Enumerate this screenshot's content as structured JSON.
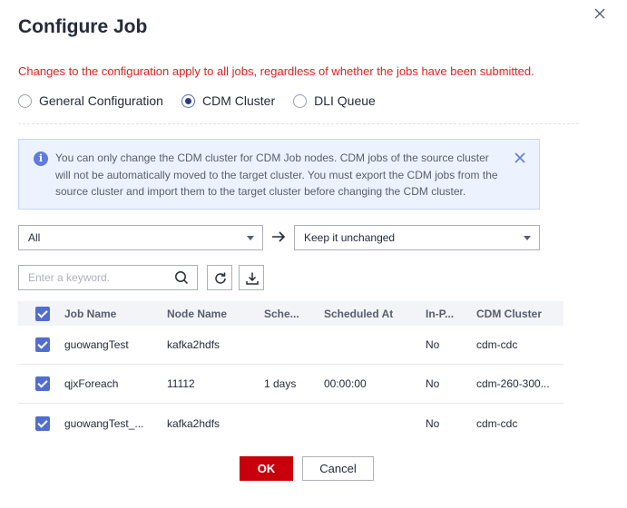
{
  "dialog": {
    "title": "Configure Job",
    "warning": "Changes to the configuration apply to all jobs, regardless of whether the jobs have been submitted."
  },
  "tabs": [
    {
      "label": "General Configuration",
      "selected": false
    },
    {
      "label": "CDM Cluster",
      "selected": true
    },
    {
      "label": "DLI Queue",
      "selected": false
    }
  ],
  "notice": {
    "text": "You can only change the CDM cluster for CDM Job nodes. CDM jobs of the source cluster will not be automatically moved to the target cluster. You must export the CDM jobs from the source cluster and import them to the target cluster before changing the CDM cluster."
  },
  "filters": {
    "source_value": "All",
    "target_value": "Keep it unchanged"
  },
  "search": {
    "placeholder": "Enter a keyword."
  },
  "table": {
    "columns": [
      "Job Name",
      "Node Name",
      "Sche...",
      "Scheduled At",
      "In-P...",
      "CDM Cluster"
    ],
    "rows": [
      {
        "job": "guowangTest",
        "node": "kafka2hdfs",
        "schedule": "",
        "at": "",
        "inp": "No",
        "cluster": "cdm-cdc"
      },
      {
        "job": "qjxForeach",
        "node": "11112",
        "schedule": "1 days",
        "at": "00:00:00",
        "inp": "No",
        "cluster": "cdm-260-300..."
      },
      {
        "job": "guowangTest_...",
        "node": "kafka2hdfs",
        "schedule": "",
        "at": "",
        "inp": "No",
        "cluster": "cdm-cdc"
      }
    ]
  },
  "footer": {
    "ok_label": "OK",
    "cancel_label": "Cancel"
  },
  "colors": {
    "primary": "#c7000b",
    "accent": "#526ecc",
    "warning_text": "#e02020",
    "info_bg": "#edf3fe"
  }
}
